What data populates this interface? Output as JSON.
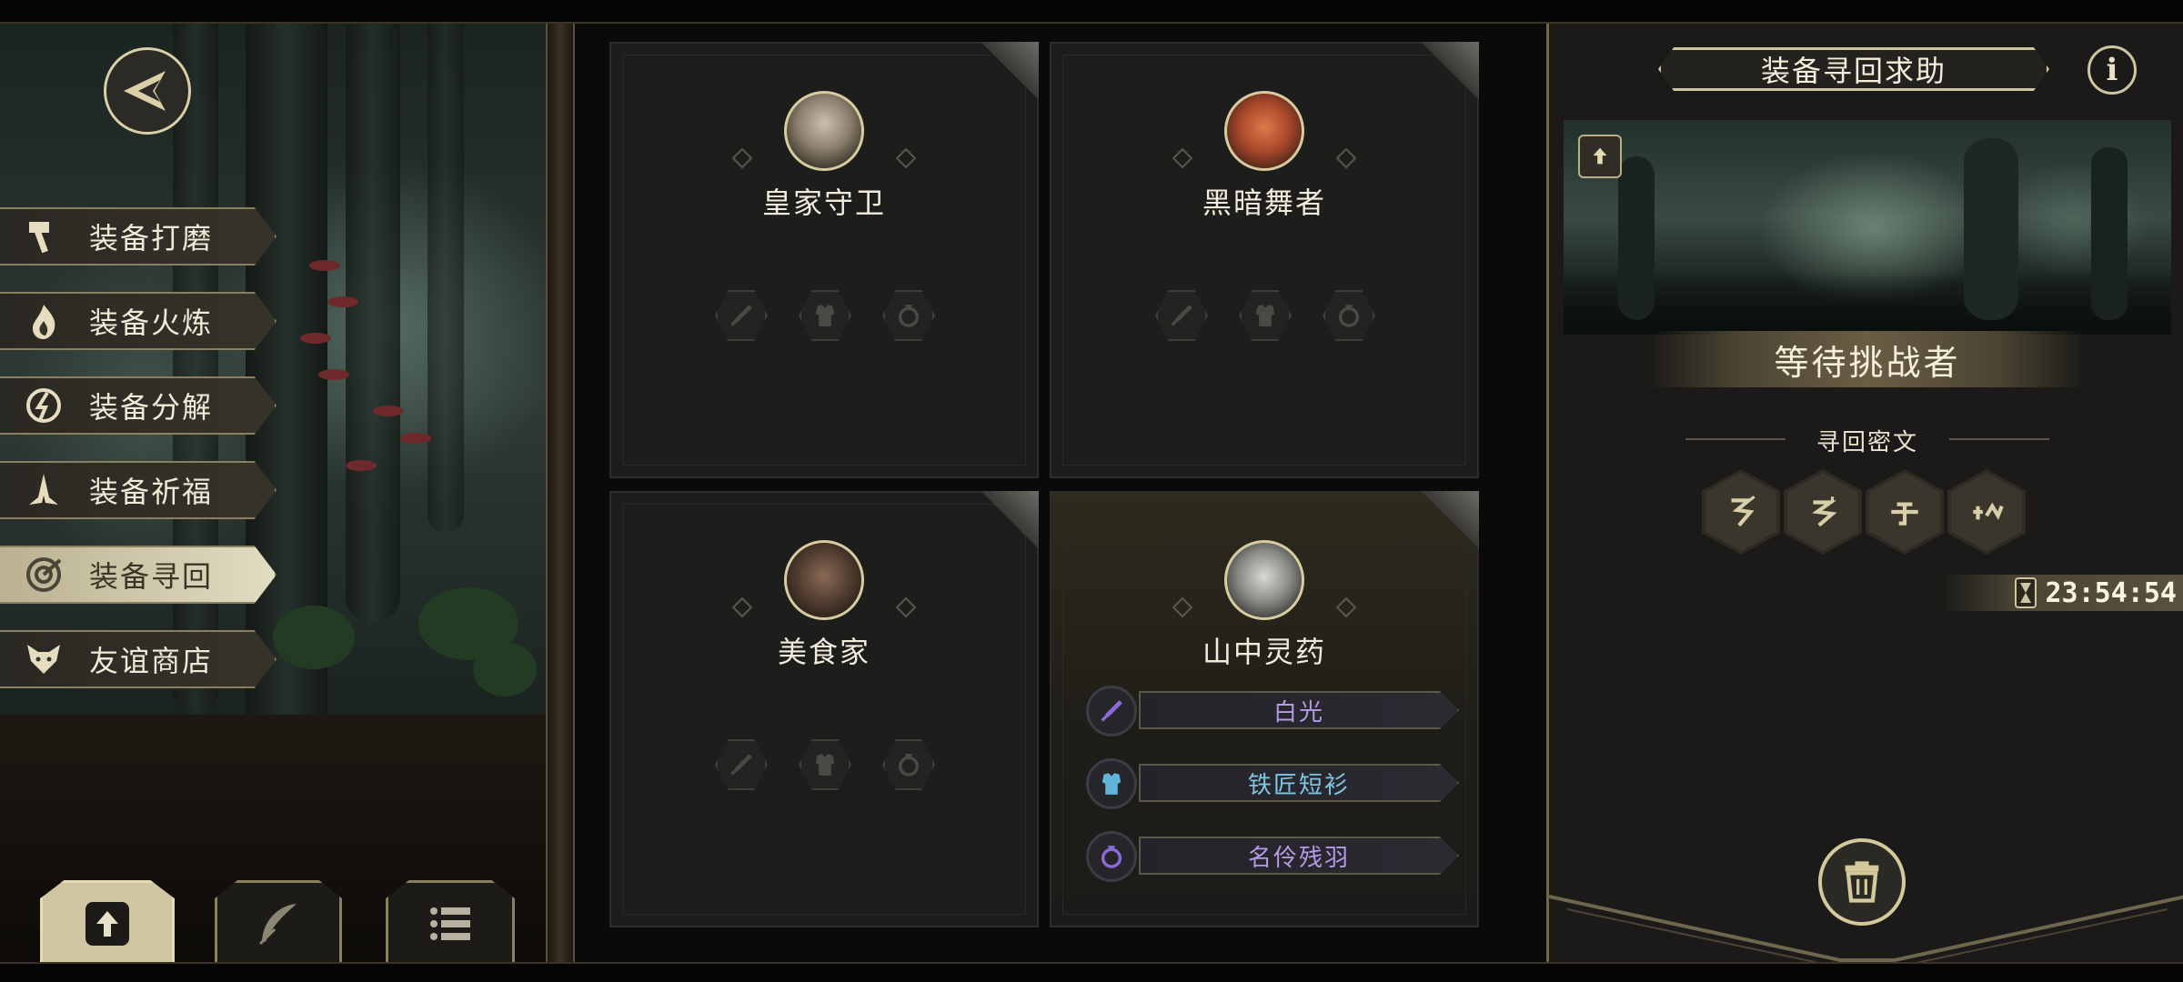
{
  "menu": [
    {
      "label": "装备打磨",
      "icon": "hammer-icon"
    },
    {
      "label": "装备火炼",
      "icon": "flame-icon"
    },
    {
      "label": "装备分解",
      "icon": "decompose-icon"
    },
    {
      "label": "装备祈福",
      "icon": "pray-icon"
    },
    {
      "label": "装备寻回",
      "icon": "target-icon",
      "active": true
    },
    {
      "label": "友谊商店",
      "icon": "fox-icon"
    }
  ],
  "bottom_tabs": [
    {
      "icon": "upload-icon",
      "active": true
    },
    {
      "icon": "feather-icon"
    },
    {
      "icon": "list-icon"
    }
  ],
  "cards": [
    {
      "name": "皇家守卫",
      "portrait": "royal-guard-portrait"
    },
    {
      "name": "黑暗舞者",
      "portrait": "dark-dancer-portrait"
    },
    {
      "name": "美食家",
      "portrait": "gourmet-portrait"
    },
    {
      "name": "山中灵药",
      "portrait": "mountain-elixir-portrait",
      "equipment": [
        {
          "name": "白光",
          "icon": "sword-icon",
          "color": "#b59ae6"
        },
        {
          "name": "铁匠短衫",
          "icon": "armor-icon",
          "color": "#7fc6e6"
        },
        {
          "name": "名伶残羽",
          "icon": "ring-icon",
          "color": "#b59ae6"
        }
      ]
    }
  ],
  "right": {
    "title": "装备寻回求助",
    "info_label": "i",
    "status": "等待挑战者",
    "cipher_label": "寻回密文",
    "timer": "23:54:54"
  },
  "colors": {
    "accent_gold": "#cfc5a0",
    "purple": "#b59ae6",
    "blue": "#7fc6e6"
  }
}
